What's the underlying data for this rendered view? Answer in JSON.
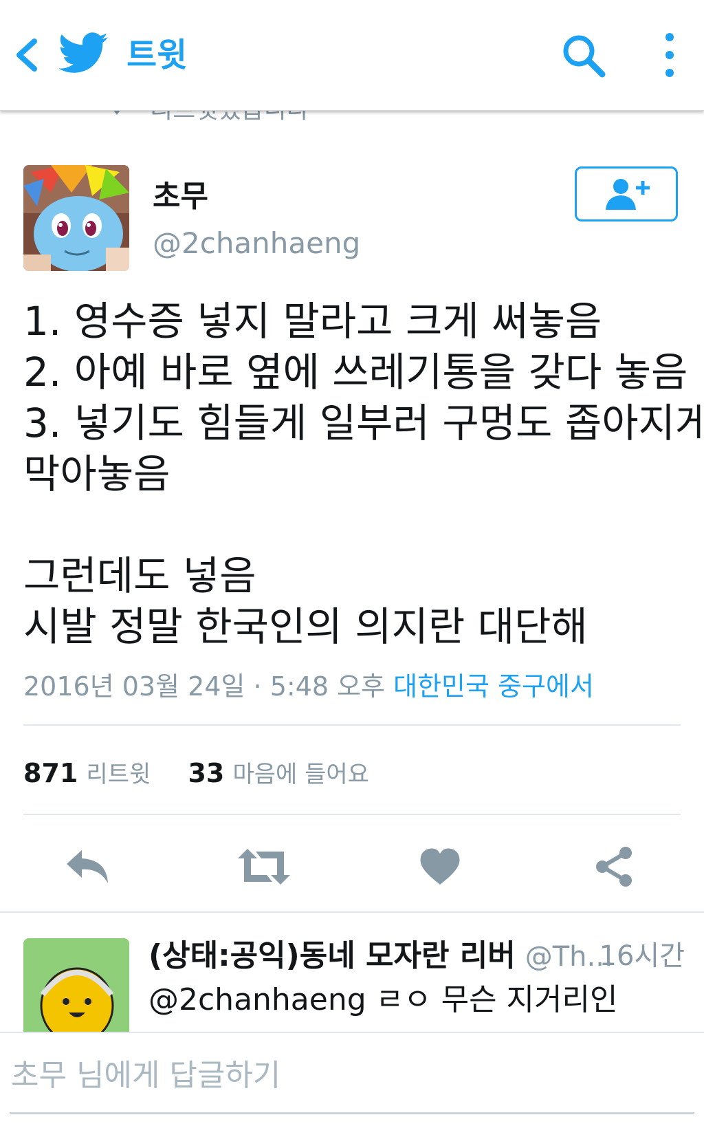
{
  "topbar": {
    "title": "트윗",
    "icons": [
      "chevron-left-icon",
      "twitter-bird-icon",
      "search-icon",
      "more-vertical-icon"
    ],
    "accent_color": "#1da1f2"
  },
  "retweet_context": {
    "text": "리트윗했습니다",
    "icon": "retweet-icon"
  },
  "tweet": {
    "author_name": "초무",
    "author_handle": "@2chanhaeng",
    "text_lines": [
      "1. 영수증 넣지 말라고 크게 써놓음",
      "2. 아예 바로 옆에 쓰레기통을 갖다 놓음",
      "3. 넣기도 힘들게 일부러 구멍도 좁아지게",
      "막아놓음",
      "",
      "그런데도 넣음",
      "시발 정말 한국인의 의지란 대단해"
    ],
    "timestamp": "2016년 03월 24일 · 5:48 오후",
    "location": "대한민국 중구에서",
    "retweet_count": "871",
    "retweet_label": "리트윗",
    "like_count": "33",
    "like_label": "마음에 들어요"
  },
  "actions": [
    {
      "name": "reply",
      "icon": "reply-icon"
    },
    {
      "name": "retweet",
      "icon": "retweet-icon"
    },
    {
      "name": "like",
      "icon": "heart-icon"
    },
    {
      "name": "share",
      "icon": "share-icon"
    }
  ],
  "reply": {
    "name": "(상태:공익)동네 모자란 리버",
    "handle": "@Th...",
    "time": "16시간",
    "text": "@2chanhaeng ㄹㅇ 무슨 지거리인"
  },
  "composer": {
    "placeholder": "초무 님에게 답글하기"
  },
  "colors": {
    "text_primary": "#14171a",
    "text_secondary": "#8899a6",
    "icon_gray": "#8899a6",
    "divider": "#e1e8ed"
  }
}
